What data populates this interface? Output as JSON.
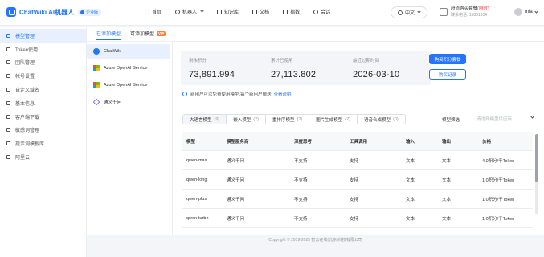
{
  "app": {
    "name": "ChatWiki AI机器人",
    "edition": "企业版"
  },
  "nav": {
    "items": [
      {
        "label": "首页",
        "icon": "home-icon"
      },
      {
        "label": "机器人",
        "icon": "robot-icon"
      },
      {
        "label": "知识库",
        "icon": "library-icon"
      },
      {
        "label": "文档",
        "icon": "document-icon"
      },
      {
        "label": "指数",
        "icon": "index-icon"
      },
      {
        "label": "会话",
        "icon": "chat-icon"
      }
    ]
  },
  "header": {
    "language": "中文",
    "promo_text": "超值购买套餐",
    "promo_highlight": "(限时)",
    "promo_sub": "联系电话: 15831334",
    "user_name": "mia"
  },
  "sidebar": {
    "items": [
      {
        "label": "模型管理",
        "active": true
      },
      {
        "label": "Token使用",
        "active": false
      },
      {
        "label": "团队管理",
        "active": false
      },
      {
        "label": "帐号设置",
        "active": false
      },
      {
        "label": "自定义域名",
        "active": false
      },
      {
        "label": "基本信息",
        "active": false
      },
      {
        "label": "客户端下载",
        "active": false
      },
      {
        "label": "敏感词管理",
        "active": false
      },
      {
        "label": "提示词模板库",
        "active": false
      },
      {
        "label": "阿里云",
        "active": false
      }
    ]
  },
  "tabs": [
    {
      "label": "已添加模型",
      "active": true,
      "vip": false
    },
    {
      "label": "可添加模型",
      "active": false,
      "vip": true
    }
  ],
  "vip_label": "VIP",
  "providers": [
    {
      "label": "ChatWiki",
      "icon": "chatwiki-icon",
      "active": true
    },
    {
      "label": "Azure OpenAI Service",
      "icon": "microsoft-icon",
      "active": false
    },
    {
      "label": "Azure OpenAI Service",
      "icon": "microsoft-icon",
      "active": false
    },
    {
      "label": "通义千问",
      "icon": "tongyi-icon",
      "active": false
    }
  ],
  "stats": [
    {
      "label": "剩余积分",
      "value": "73,891.994"
    },
    {
      "label": "累计已使用",
      "value": "27,113.802"
    },
    {
      "label": "最近过期时间",
      "value": "2026-03-10"
    }
  ],
  "buttons": {
    "buy": "购买积分套餐",
    "records": "购买记录"
  },
  "notice": {
    "text": "新用户可以免费使用模型,每个新用户赠送",
    "link": "查看说明"
  },
  "type_tabs": [
    {
      "label": "大语言模型",
      "count": "(9)",
      "active": true
    },
    {
      "label": "嵌入模型",
      "count": "(2)",
      "active": false
    },
    {
      "label": "重排序模型",
      "count": "(2)",
      "active": false
    },
    {
      "label": "图片生成模型",
      "count": "(2)",
      "active": false
    },
    {
      "label": "语音合成模型",
      "count": "(0)",
      "active": false
    }
  ],
  "search": {
    "label": "模型筛选:",
    "placeholder": "请选择模型供应商"
  },
  "table": {
    "headers": [
      "模型",
      "模型服务商",
      "深度思考",
      "工具调用",
      "输入",
      "输出",
      "价格"
    ],
    "rows": [
      [
        "qwen-max",
        "通义千问",
        "不支持",
        "支持",
        "文本",
        "文本",
        "4.0积分/千Token"
      ],
      [
        "qwen-long",
        "通义千问",
        "不支持",
        "支持",
        "文本",
        "文本",
        "1.0积分/千Token"
      ],
      [
        "qwen-plus",
        "通义千问",
        "不支持",
        "支持",
        "文本",
        "文本",
        "1.0积分/千Token"
      ],
      [
        "qwen-turbo",
        "通义千问",
        "不支持",
        "支持",
        "文本",
        "文本",
        "1.0积分/千Token"
      ]
    ]
  },
  "footer": {
    "copyright": "Copyright © 2019-2025 智云在线(北京)科技有限公司"
  },
  "colors": {
    "accent": "#2475fc",
    "vip": "#ff7d3b"
  }
}
